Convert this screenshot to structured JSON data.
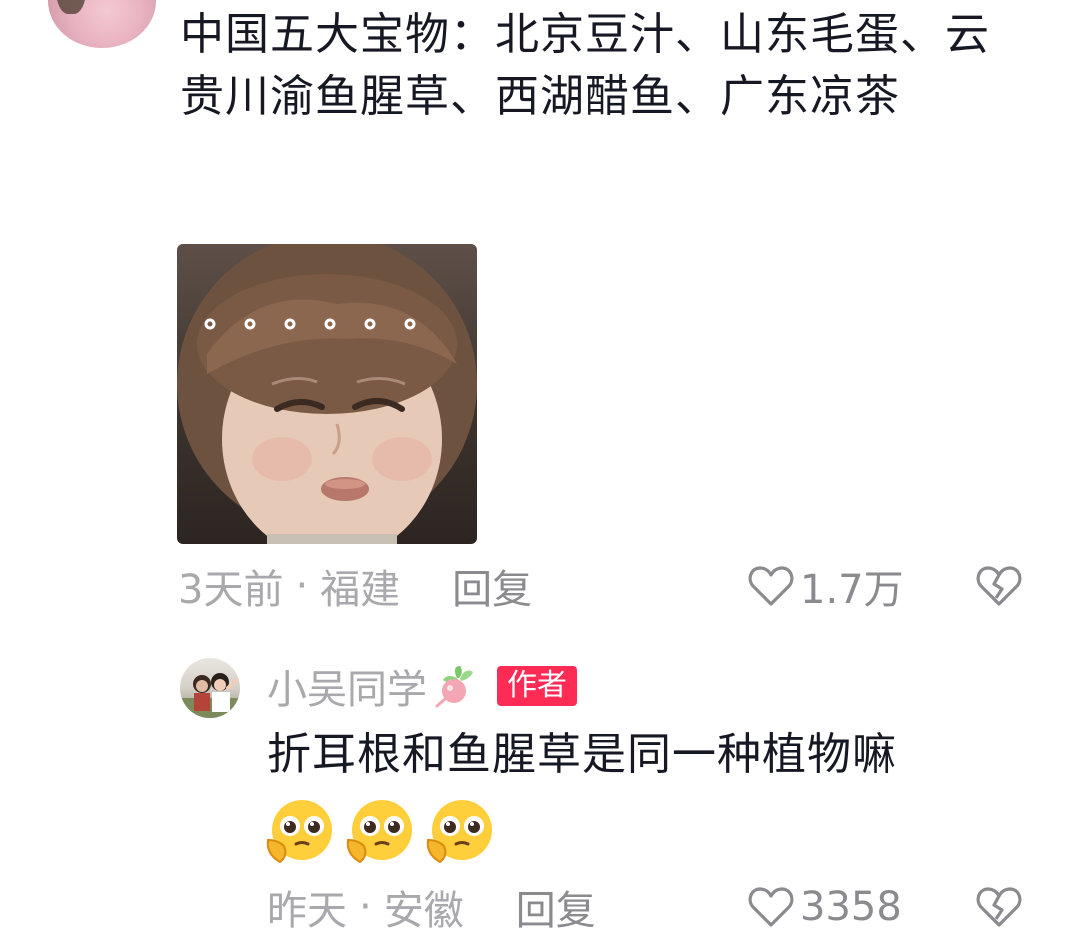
{
  "comments": [
    {
      "text": "中国五大宝物：北京豆汁、山东毛蛋、云贵川渝鱼腥草、西湖醋鱼、广东凉茶",
      "meme_caption": "。。。。。。",
      "time": "3天前",
      "separator": "·",
      "location": "福建",
      "reply_label": "回复",
      "likes": "1.7万"
    },
    {
      "username": "小吴同学",
      "badge": "作者",
      "text": "折耳根和鱼腥草是同一种植物嘛",
      "time": "昨天",
      "separator": "·",
      "location": "安徽",
      "reply_label": "回复",
      "likes": "3358"
    }
  ],
  "icons": {
    "like": "heart-outline-icon",
    "dislike": "broken-heart-icon",
    "username_decoration": "radish-icon",
    "emoji": "pleading-face-emoji"
  },
  "colors": {
    "text": "#161823",
    "meta": "#a8a8ad",
    "action": "#8a8a8f",
    "badge": "#fe2c55"
  }
}
